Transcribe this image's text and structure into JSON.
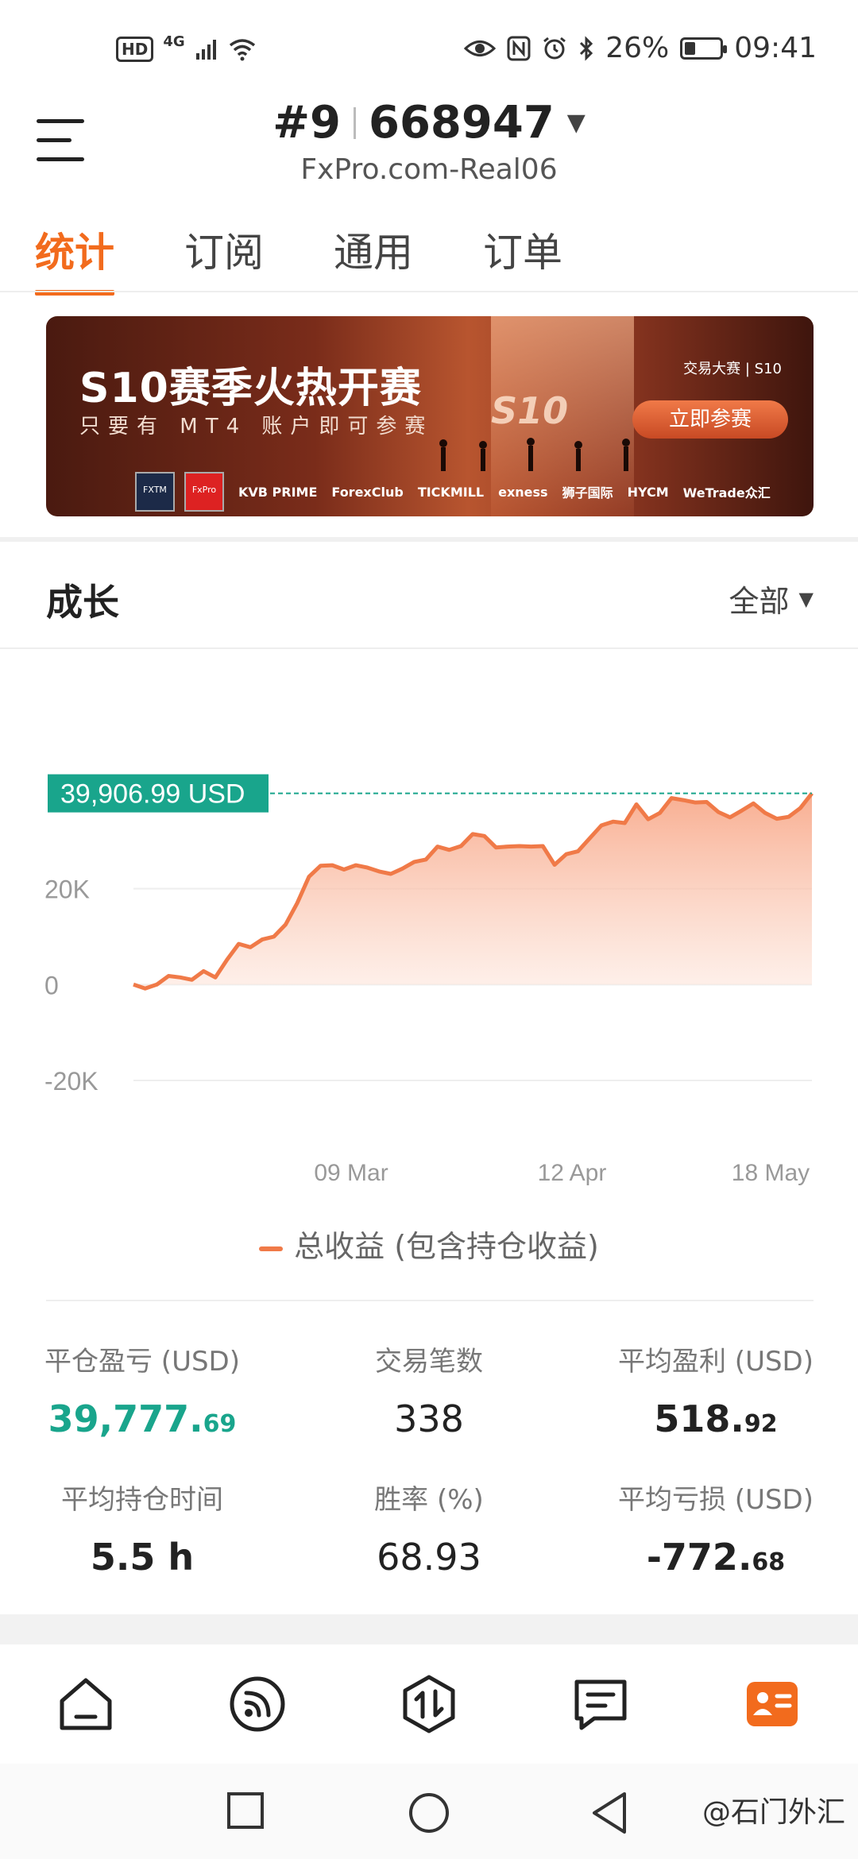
{
  "status_bar": {
    "network_hd": "HD",
    "network_type": "4G",
    "battery_percent": "26%",
    "battery_level": 0.26,
    "time": "09:41"
  },
  "header": {
    "account_prefix": "#9",
    "account_number": "668947",
    "server": "FxPro.com-Real06"
  },
  "tabs": [
    {
      "label": "统计",
      "active": true
    },
    {
      "label": "订阅",
      "active": false
    },
    {
      "label": "通用",
      "active": false
    },
    {
      "label": "订单",
      "active": false
    }
  ],
  "banner": {
    "title": "S10赛季火热开赛",
    "subtitle": "只要有 MT4 账户即可参赛",
    "tag": "交易大赛 | S10",
    "cta": "立即参赛",
    "emblem": "S10",
    "sponsors": [
      "FXTM",
      "FxPro",
      "KVB PRIME",
      "ForexClub",
      "TICKMILL",
      "exness",
      "狮子国际",
      "HYCM",
      "WeTrade众汇"
    ]
  },
  "growth": {
    "title": "成长",
    "filter": "全部"
  },
  "chart_data": {
    "type": "area",
    "current_value_label": "39,906.99 USD",
    "y_ticks": [
      "20K",
      "0",
      "-20K"
    ],
    "y_tick_values": [
      20000,
      0,
      -20000
    ],
    "x_ticks": [
      "09 Mar",
      "12 Apr",
      "18 May"
    ],
    "ylim": [
      -20000,
      40000
    ],
    "legend": "总收益 (包含持仓收益)",
    "series": [
      {
        "name": "总收益 (包含持仓收益)",
        "values": [
          0,
          -800,
          0,
          1800,
          1500,
          1000,
          2800,
          1500,
          5200,
          8500,
          7800,
          9400,
          10000,
          12500,
          17000,
          22500,
          24800,
          24900,
          24000,
          24900,
          24400,
          23600,
          23100,
          24200,
          25600,
          26100,
          28800,
          28100,
          28900,
          31400,
          31000,
          28600,
          28800,
          28900,
          28800,
          28900,
          25000,
          27200,
          27800,
          30500,
          33200,
          34000,
          33700,
          37600,
          34500,
          35800,
          38900,
          38500,
          38000,
          38100,
          36000,
          34900,
          36300,
          37800,
          35800,
          34600,
          35000,
          36800,
          39900
        ]
      }
    ]
  },
  "stats": [
    {
      "label": "平仓盈亏 (USD)",
      "int": "39,777.",
      "dec": "69",
      "color": "green"
    },
    {
      "label": "交易笔数",
      "int": "338",
      "dec": "",
      "color": "default"
    },
    {
      "label": "平均盈利 (USD)",
      "int": "518.",
      "dec": "92",
      "color": "default"
    },
    {
      "label": "平均持仓时间",
      "int": "5.5 h",
      "dec": "",
      "color": "default"
    },
    {
      "label": "胜率 (%)",
      "int": "68.93",
      "dec": "",
      "color": "default"
    },
    {
      "label": "平均亏损 (USD)",
      "int": "-772.",
      "dec": "68",
      "color": "default"
    }
  ],
  "bottom_nav": [
    {
      "icon": "home-icon",
      "active": false
    },
    {
      "icon": "signal-feed-icon",
      "active": false
    },
    {
      "icon": "trade-icon",
      "active": false
    },
    {
      "icon": "messages-icon",
      "active": false
    },
    {
      "icon": "account-card-icon",
      "active": true
    }
  ],
  "watermark": "@石门外汇",
  "colors": {
    "accent": "#f26b1d",
    "profit": "#19a58c",
    "chart_line": "#f07a48"
  }
}
